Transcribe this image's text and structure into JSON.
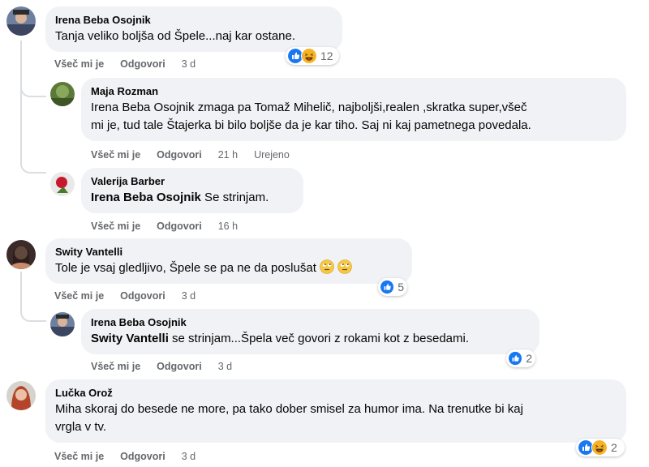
{
  "comments": [
    {
      "author": "Irena Beba Osojnik",
      "text": "Tanja veliko boljša od Špele...naj kar ostane.",
      "like": "Všeč mi je",
      "reply": "Odgovori",
      "time": "3 d",
      "reaction_count": "12",
      "reaction_icons": [
        "like-icon",
        "haha-icon"
      ]
    },
    {
      "author": "Maja Rozman",
      "text_line1": "Irena Beba Osojnik zmaga pa Tomaž Mihelič, najboljši,realen ,skratka super,všeč",
      "text_line2": "mi je, tud tale Štajerka bi bilo boljše da je kar tiho. Saj ni kaj pametnega povedala.",
      "like": "Všeč mi je",
      "reply": "Odgovori",
      "time": "21 h",
      "edited": "Urejeno"
    },
    {
      "author": "Valerija Barber",
      "mention": "Irena Beba Osojnik",
      "text": " Se strinjam.",
      "like": "Všeč mi je",
      "reply": "Odgovori",
      "time": "16 h"
    },
    {
      "author": "Swity Vantelli",
      "text": "Tole je vsaj gledljivo, Špele se pa ne da poslušat",
      "like": "Všeč mi je",
      "reply": "Odgovori",
      "time": "3 d",
      "reaction_count": "5",
      "reaction_icons": [
        "like-icon"
      ]
    },
    {
      "author": "Irena Beba Osojnik",
      "mention": "Swity Vantelli",
      "text": " se strinjam...Špela več govori z rokami kot z besedami.",
      "like": "Všeč mi je",
      "reply": "Odgovori",
      "time": "3 d",
      "reaction_count": "2",
      "reaction_icons": [
        "like-icon"
      ]
    },
    {
      "author": "Lučka Orož",
      "text_line1": "Miha skoraj do besede ne more, pa tako dober smisel za humor ima. Na trenutke bi kaj",
      "text_line2": "vrgla v tv.",
      "like": "Všeč mi je",
      "reply": "Odgovori",
      "time": "3 d",
      "reaction_count": "2",
      "reaction_icons": [
        "like-icon",
        "haha-icon"
      ]
    }
  ],
  "colors": {
    "bubble": "#f0f2f5",
    "meta_text": "#65676b",
    "like_blue": "#1877f2",
    "haha_yellow": "#f7b125"
  }
}
